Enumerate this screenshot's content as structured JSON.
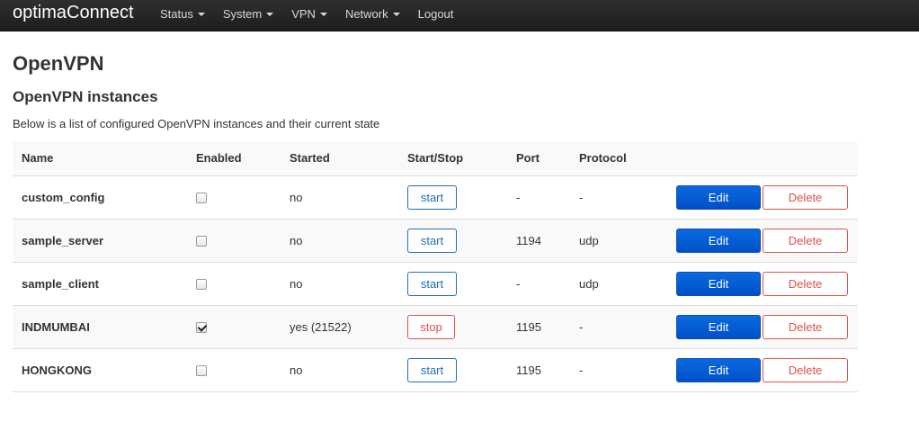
{
  "navbar": {
    "brand": "optimaConnect",
    "menu": [
      {
        "label": "Status",
        "has_dropdown": true
      },
      {
        "label": "System",
        "has_dropdown": true
      },
      {
        "label": "VPN",
        "has_dropdown": true
      },
      {
        "label": "Network",
        "has_dropdown": true
      },
      {
        "label": "Logout",
        "has_dropdown": false
      }
    ]
  },
  "page": {
    "title": "OpenVPN",
    "section_title": "OpenVPN instances",
    "description": "Below is a list of configured OpenVPN instances and their current state"
  },
  "table": {
    "headers": [
      "Name",
      "Enabled",
      "Started",
      "Start/Stop",
      "Port",
      "Protocol"
    ],
    "edit_label": "Edit",
    "delete_label": "Delete",
    "rows": [
      {
        "name": "custom_config",
        "enabled": false,
        "started": "no",
        "action": "start",
        "port": "-",
        "protocol": "-"
      },
      {
        "name": "sample_server",
        "enabled": false,
        "started": "no",
        "action": "start",
        "port": "1194",
        "protocol": "udp"
      },
      {
        "name": "sample_client",
        "enabled": false,
        "started": "no",
        "action": "start",
        "port": "-",
        "protocol": "udp"
      },
      {
        "name": "INDMUMBAI",
        "enabled": true,
        "started": "yes (21522)",
        "action": "stop",
        "port": "1195",
        "protocol": "-"
      },
      {
        "name": "HONGKONG",
        "enabled": false,
        "started": "no",
        "action": "start",
        "port": "1195",
        "protocol": "-"
      }
    ]
  },
  "colors": {
    "navbar_bg": "#222222",
    "primary": "#0a6ae0",
    "start_border": "#1f6fb5",
    "danger": "#d9534f"
  }
}
